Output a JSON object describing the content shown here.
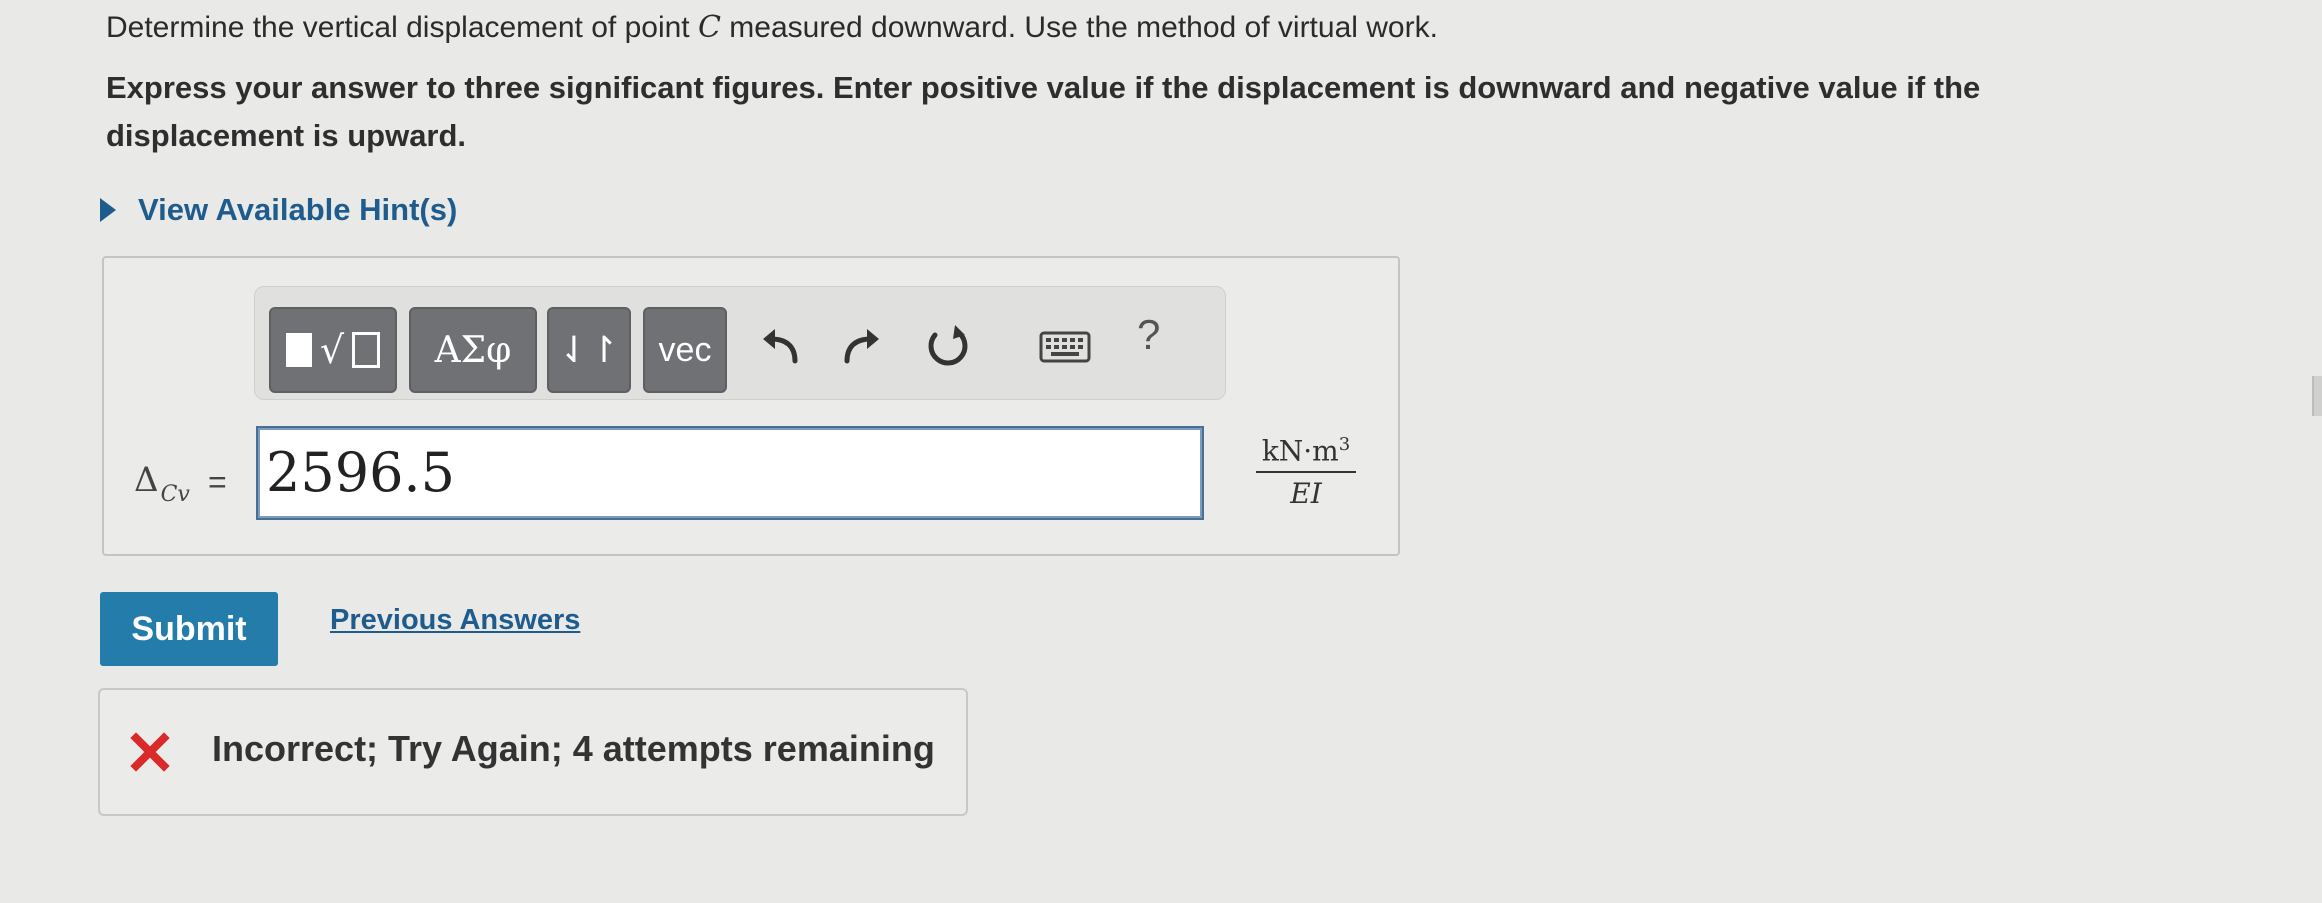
{
  "question": {
    "line1_before": "Determine the vertical displacement of point ",
    "line1_var": "C",
    "line1_after": " measured downward. Use the method of virtual work.",
    "instructions": "Express your answer to three significant figures. Enter positive value if the displacement is downward and negative value if the displacement is upward."
  },
  "hints": {
    "label": "View Available Hint(s)"
  },
  "toolbar": {
    "template_icon": "template-radical-icon",
    "greek_label": "ΑΣφ",
    "arrows_label": "⇃↾",
    "vec_label": "vec",
    "undo_icon": "undo-icon",
    "redo_icon": "redo-icon",
    "reset_icon": "reset-icon",
    "keyboard_icon": "keyboard-icon",
    "help_label": "?"
  },
  "answer": {
    "label_symbol": "Δ",
    "label_sub": "Cv",
    "equals": "=",
    "value": "2596.5",
    "units_numerator": "kN·m",
    "units_exponent": "3",
    "units_denominator": "EI"
  },
  "actions": {
    "submit_label": "Submit",
    "previous_answers_label": "Previous Answers"
  },
  "feedback": {
    "icon": "x-mark-icon",
    "text": "Incorrect; Try Again; 4 attempts remaining",
    "icon_color": "#d92a2a"
  },
  "colors": {
    "link": "#1f5c8e",
    "submit_bg": "#247caa",
    "toolbar_button": "#6f7175",
    "background": "#e9e9e7"
  }
}
